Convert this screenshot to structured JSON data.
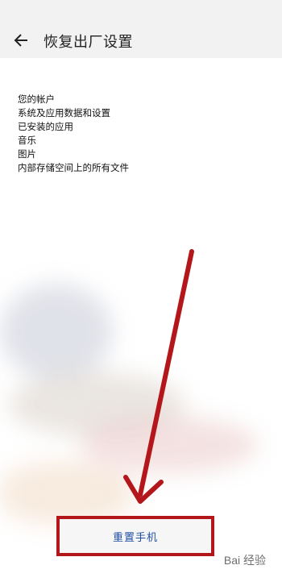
{
  "header": {
    "back_icon": "back-arrow-icon",
    "title": "恢复出厂设置"
  },
  "content": {
    "items": [
      "您的帐户",
      "系统及应用数据和设置",
      "已安装的应用",
      "音乐",
      "图片",
      "内部存储空间上的所有文件"
    ]
  },
  "actions": {
    "reset_label": "重置手机"
  },
  "watermark": {
    "text": "Bai 经验"
  },
  "colors": {
    "accent_blue": "#1f4fa3",
    "annotation_red": "#b3161b"
  }
}
